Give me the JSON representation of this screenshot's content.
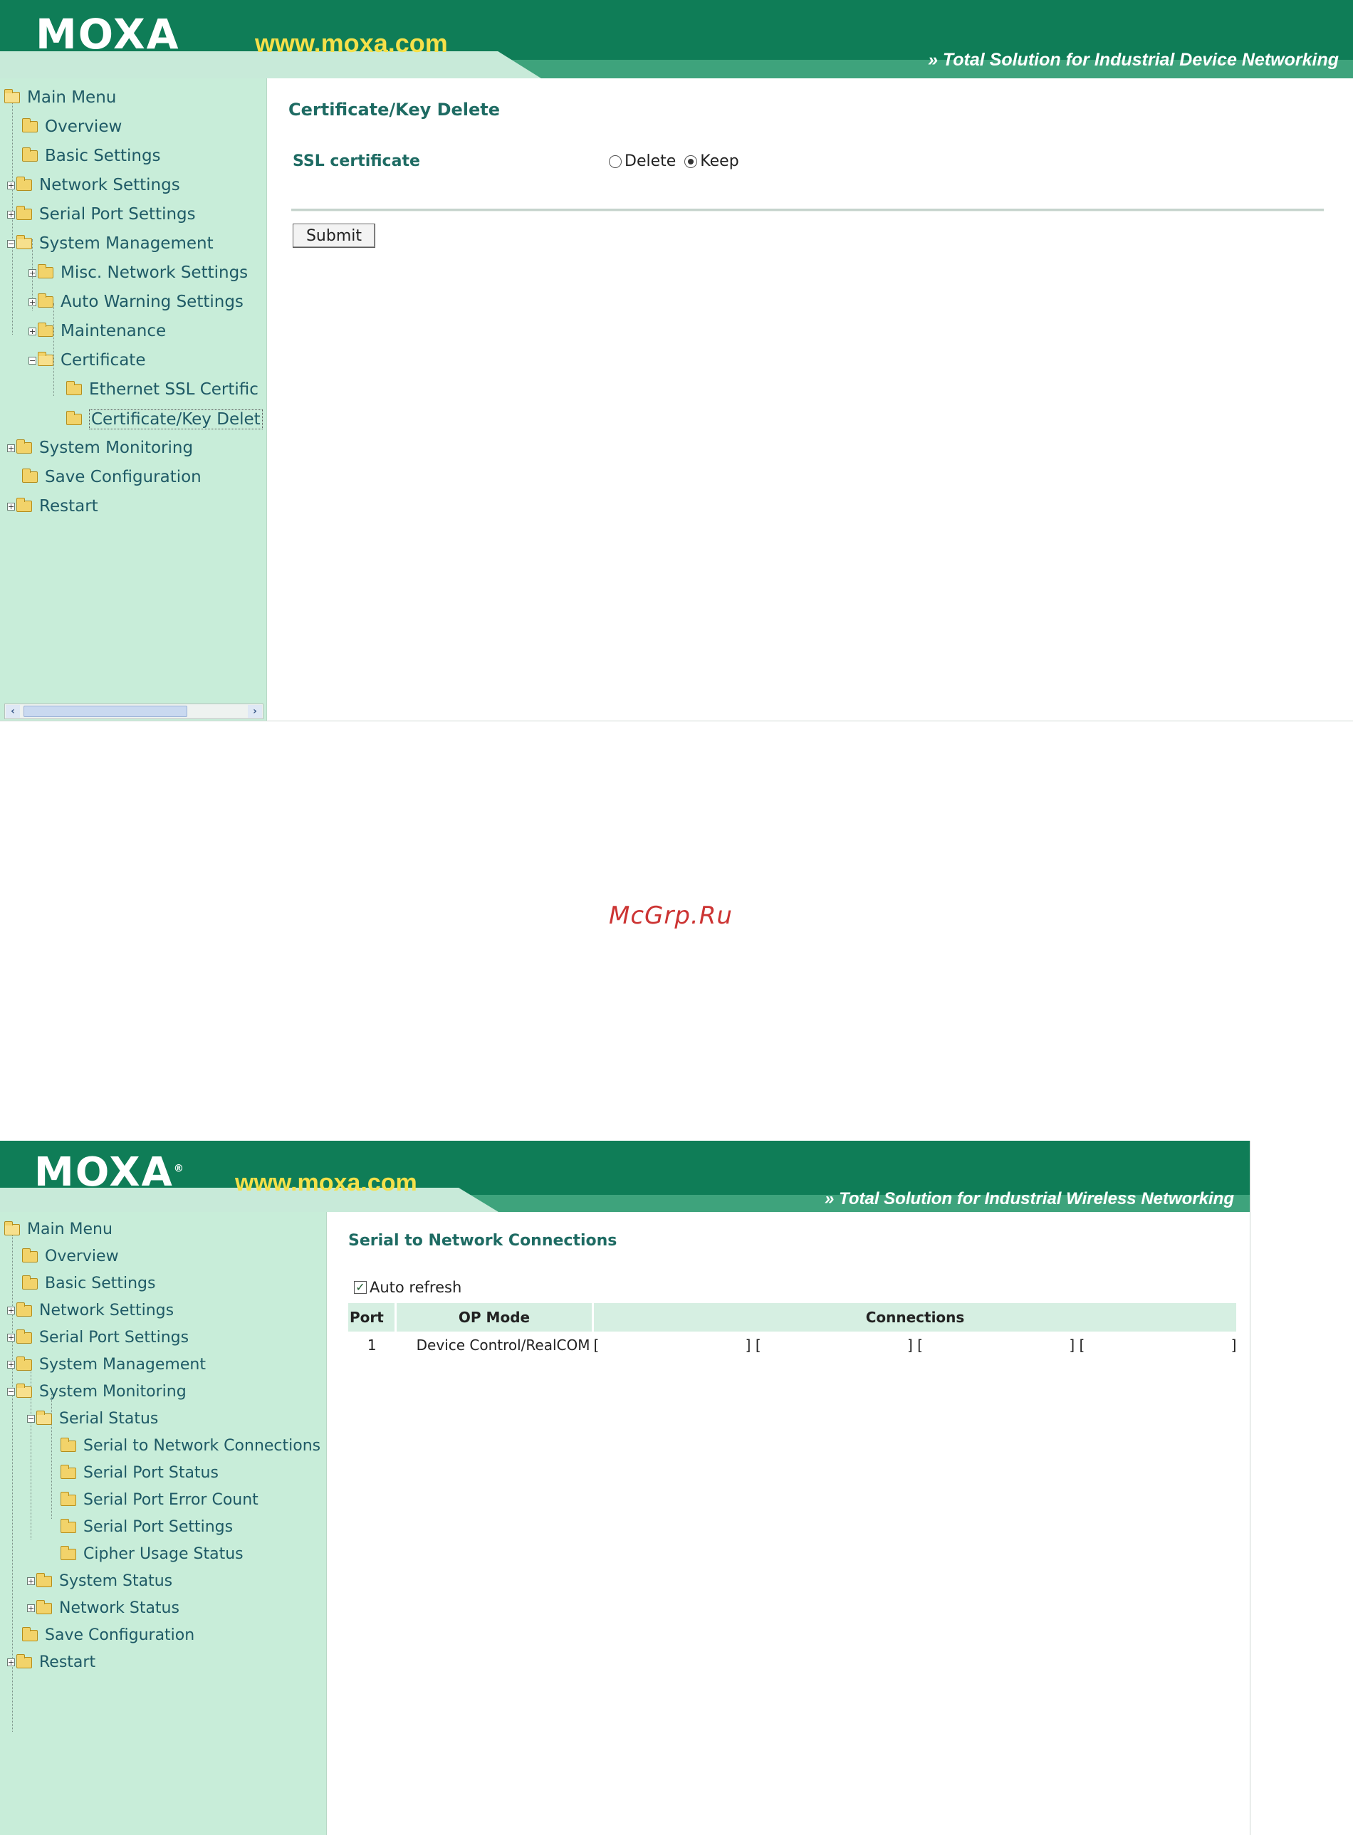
{
  "screen1": {
    "brand": "MOXA",
    "website": "www.moxa.com",
    "tagline": "Total Solution for Industrial Device Networking",
    "menu": [
      {
        "label": "Main Menu"
      },
      {
        "label": "Overview"
      },
      {
        "label": "Basic Settings"
      },
      {
        "label": "Network Settings"
      },
      {
        "label": "Serial Port Settings"
      },
      {
        "label": "System Management"
      },
      {
        "label": "Misc. Network Settings"
      },
      {
        "label": "Auto Warning Settings"
      },
      {
        "label": "Maintenance"
      },
      {
        "label": "Certificate"
      },
      {
        "label": "Ethernet SSL Certific"
      },
      {
        "label": "Certificate/Key Delet"
      },
      {
        "label": "System Monitoring"
      },
      {
        "label": "Save Configuration"
      },
      {
        "label": "Restart"
      }
    ],
    "page_title": "Certificate/Key Delete",
    "field_label": "SSL certificate",
    "options": [
      "Delete",
      "Keep"
    ],
    "selected_option": "Keep",
    "submit_label": "Submit"
  },
  "watermark": "McGrp.Ru",
  "screen2": {
    "brand": "MOXA",
    "registered": "®",
    "website": "www.moxa.com",
    "tagline": "Total Solution for Industrial Wireless Networking",
    "menu": [
      {
        "label": "Main Menu"
      },
      {
        "label": "Overview"
      },
      {
        "label": "Basic Settings"
      },
      {
        "label": "Network Settings"
      },
      {
        "label": "Serial Port Settings"
      },
      {
        "label": "System Management"
      },
      {
        "label": "System Monitoring"
      },
      {
        "label": "Serial Status"
      },
      {
        "label": "Serial to Network Connections"
      },
      {
        "label": "Serial Port Status"
      },
      {
        "label": "Serial Port Error Count"
      },
      {
        "label": "Serial Port Settings"
      },
      {
        "label": "Cipher Usage Status"
      },
      {
        "label": "System Status"
      },
      {
        "label": "Network Status"
      },
      {
        "label": "Save Configuration"
      },
      {
        "label": "Restart"
      }
    ],
    "page_title": "Serial to Network Connections",
    "auto_refresh_label": "Auto refresh",
    "auto_refresh_checked": true,
    "table": {
      "headers": [
        "Port",
        "OP Mode",
        "Connections"
      ],
      "rows": [
        {
          "port": "1",
          "op_mode": "Device Control/RealCOM",
          "connections": [
            "[",
            "] [",
            "] [",
            "] [",
            "]"
          ]
        }
      ]
    }
  }
}
